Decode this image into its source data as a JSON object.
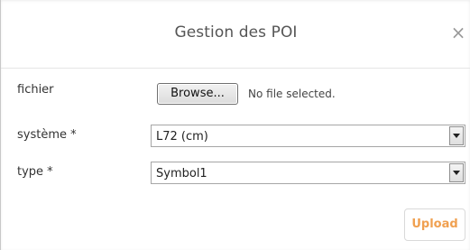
{
  "dialog": {
    "title": "Gestion des POI",
    "close_glyph": "×"
  },
  "form": {
    "file": {
      "label": "fichier",
      "browse_label": "Browse...",
      "status": "No file selected."
    },
    "system": {
      "label": "système *",
      "selected": "L72 (cm)"
    },
    "type": {
      "label": "type *",
      "selected": "Symbol1"
    }
  },
  "actions": {
    "upload_label": "Upload"
  },
  "colors": {
    "upload_text": "#f0a050",
    "title_text": "#555555"
  },
  "icons": {
    "close": "close-icon",
    "dropdown": "chevron-down-icon"
  }
}
